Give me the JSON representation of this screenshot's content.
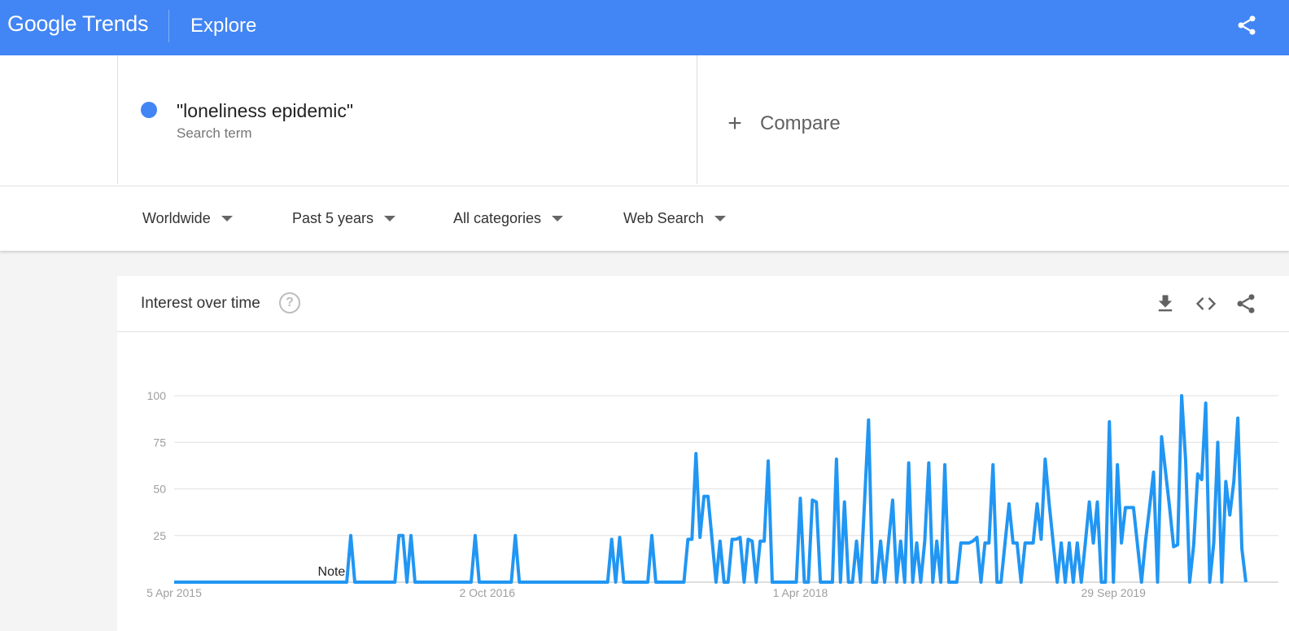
{
  "header": {
    "logo_google": "Google",
    "logo_trends": "Trends",
    "title": "Explore",
    "share_icon": "share-icon"
  },
  "search": {
    "term": "\"loneliness epidemic\"",
    "term_type": "Search term",
    "term_color": "#4285f4",
    "compare_label": "Compare"
  },
  "filters": [
    {
      "label": "Worldwide"
    },
    {
      "label": "Past 5 years"
    },
    {
      "label": "All categories"
    },
    {
      "label": "Web Search"
    }
  ],
  "card": {
    "title": "Interest over time",
    "help_icon": "?",
    "tools": [
      "download-icon",
      "embed-icon",
      "share-icon"
    ]
  },
  "chart_data": {
    "type": "line",
    "title": "",
    "xlabel": "",
    "ylabel": "",
    "ylim": [
      0,
      100
    ],
    "yticks": [
      25,
      50,
      75,
      100
    ],
    "grid": true,
    "line_color": "#2196f3",
    "xticks": [
      {
        "label": "5 Apr 2015",
        "week": 0
      },
      {
        "label": "2 Oct 2016",
        "week": 78
      },
      {
        "label": "1 Apr 2018",
        "week": 156
      },
      {
        "label": "29 Sep 2019",
        "week": 234
      }
    ],
    "annotations": [
      {
        "label": "Note",
        "week": 38
      }
    ],
    "series": [
      {
        "values": [
          0,
          0,
          0,
          0,
          0,
          0,
          0,
          0,
          0,
          0,
          0,
          0,
          0,
          0,
          0,
          0,
          0,
          0,
          0,
          0,
          0,
          0,
          0,
          0,
          0,
          0,
          0,
          0,
          0,
          0,
          0,
          0,
          0,
          0,
          0,
          0,
          0,
          0,
          0,
          0,
          0,
          0,
          0,
          0,
          25,
          0,
          0,
          0,
          0,
          0,
          0,
          0,
          0,
          0,
          0,
          0,
          25,
          25,
          0,
          25,
          0,
          0,
          0,
          0,
          0,
          0,
          0,
          0,
          0,
          0,
          0,
          0,
          0,
          0,
          0,
          25,
          0,
          0,
          0,
          0,
          0,
          0,
          0,
          0,
          0,
          25,
          0,
          0,
          0,
          0,
          0,
          0,
          0,
          0,
          0,
          0,
          0,
          0,
          0,
          0,
          0,
          0,
          0,
          0,
          0,
          0,
          0,
          0,
          0,
          23,
          0,
          24,
          0,
          0,
          0,
          0,
          0,
          0,
          0,
          25,
          0,
          0,
          0,
          0,
          0,
          0,
          0,
          0,
          23,
          23,
          69,
          24,
          46,
          46,
          23,
          0,
          22,
          0,
          0,
          23,
          23,
          24,
          0,
          23,
          22,
          0,
          22,
          22,
          65,
          0,
          0,
          0,
          0,
          0,
          0,
          0,
          45,
          0,
          0,
          44,
          43,
          0,
          0,
          0,
          0,
          66,
          0,
          43,
          0,
          0,
          22,
          0,
          43,
          87,
          0,
          0,
          22,
          0,
          22,
          44,
          0,
          22,
          0,
          64,
          0,
          21,
          0,
          22,
          64,
          0,
          22,
          0,
          63,
          0,
          0,
          0,
          21,
          21,
          21,
          22,
          24,
          0,
          21,
          21,
          63,
          0,
          0,
          21,
          42,
          21,
          21,
          0,
          21,
          21,
          21,
          42,
          23,
          66,
          42,
          21,
          0,
          21,
          0,
          21,
          0,
          21,
          0,
          21,
          43,
          21,
          43,
          0,
          0,
          86,
          0,
          63,
          21,
          40,
          40,
          40,
          20,
          0,
          22,
          40,
          59,
          0,
          78,
          59,
          40,
          19,
          20,
          100,
          65,
          0,
          20,
          58,
          55,
          96,
          0,
          21,
          75,
          0,
          54,
          36,
          54,
          88,
          18,
          0
        ]
      }
    ]
  }
}
